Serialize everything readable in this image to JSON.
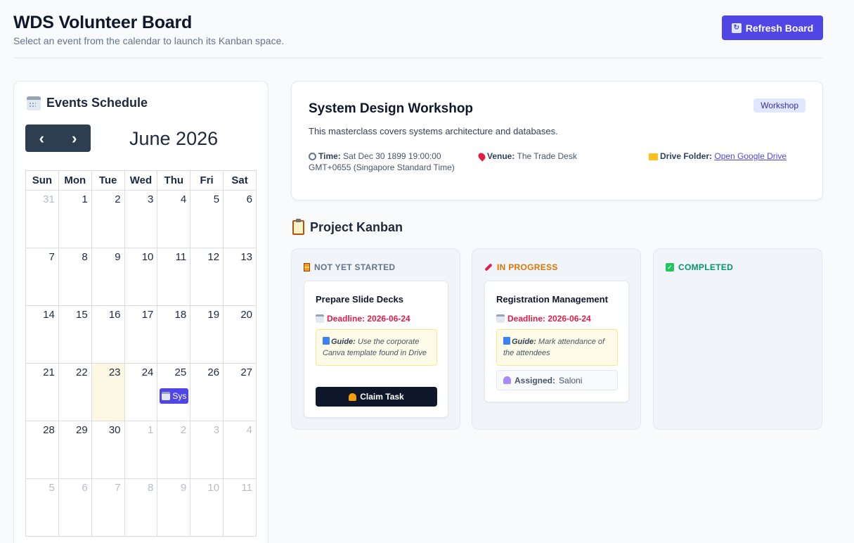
{
  "header": {
    "title": "WDS Volunteer Board",
    "subtitle": "Select an event from the calendar to launch its Kanban space.",
    "refresh_label": "Refresh Board"
  },
  "calendar": {
    "heading": "Events Schedule",
    "month_title": "June 2026",
    "prev_symbol": "‹",
    "next_symbol": "›",
    "weekdays": [
      "Sun",
      "Mon",
      "Tue",
      "Wed",
      "Thu",
      "Fri",
      "Sat"
    ],
    "weeks": [
      [
        "31",
        "1",
        "2",
        "3",
        "4",
        "5",
        "6"
      ],
      [
        "7",
        "8",
        "9",
        "10",
        "11",
        "12",
        "13"
      ],
      [
        "14",
        "15",
        "16",
        "17",
        "18",
        "19",
        "20"
      ],
      [
        "21",
        "22",
        "23",
        "24",
        "25",
        "26",
        "27"
      ],
      [
        "28",
        "29",
        "30",
        "1",
        "2",
        "3",
        "4"
      ],
      [
        "5",
        "6",
        "7",
        "8",
        "9",
        "10",
        "11"
      ]
    ],
    "event_chip": "Sys"
  },
  "event": {
    "title": "System Design Workshop",
    "badge": "Workshop",
    "description": "This masterclass covers systems architecture and databases.",
    "time_label": "Time:",
    "time_line1": "Sat Dec 30 1899 19:00:00",
    "time_line2": "GMT+0655 (Singapore Standard Time)",
    "venue_label": "Venue:",
    "venue": "The Trade Desk",
    "drive_label": "Drive Folder:",
    "drive_link": "Open Google Drive"
  },
  "kanban": {
    "heading": "Project Kanban",
    "columns": [
      {
        "title": "NOT YET STARTED",
        "color": "#64748b"
      },
      {
        "title": "IN PROGRESS",
        "color": "#d97706"
      },
      {
        "title": "COMPLETED",
        "color": "#059669"
      }
    ],
    "tasks": [
      {
        "title": "Prepare Slide Decks",
        "deadline": "Deadline: 2026-06-24",
        "guide_label": "Guide:",
        "guide_text": "Use the corporate Canva template found in Drive",
        "claim_label": "Claim Task"
      },
      {
        "title": "Registration Management",
        "deadline": "Deadline: 2026-06-24",
        "guide_label": "Guide:",
        "guide_text": "Mark attendance of the attendees",
        "assigned_label": "Assigned:",
        "assigned_to": "Saloni"
      }
    ]
  },
  "colors": {
    "accent": "#4f46e5",
    "nav_dark": "#2c3e50",
    "today_bg": "#fcf8e3",
    "deadline": "#e11d48"
  }
}
